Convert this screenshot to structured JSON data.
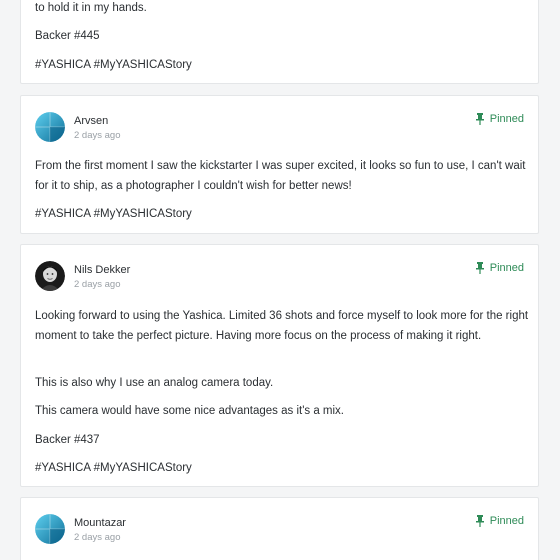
{
  "posts": [
    {
      "paragraphs": [
        "to hold it in my hands.",
        "Backer #445",
        "#YASHICA #MyYASHICAStory"
      ]
    },
    {
      "author": "Arvsen",
      "date": "2 days ago",
      "pinned_label": "Pinned",
      "avatar_icon": "teal-sphere-avatar-icon",
      "paragraphs": [
        "From the first moment I saw the kickstarter I was super excited, it looks so fun to use, I can't wait for it to ship, as a photographer I couldn't wish for better news!",
        "#YASHICA #MyYASHICAStory"
      ]
    },
    {
      "author": "Nils Dekker",
      "date": "2 days ago",
      "pinned_label": "Pinned",
      "avatar_icon": "user-photo-avatar",
      "paragraphs": [
        "Looking forward to using the Yashica. Limited 36 shots and force myself to look more for the right moment to take the perfect picture. Having more focus on the process of making it right.",
        "This is also why I use an analog camera today.",
        "This camera would have some nice advantages as it's a mix.",
        "Backer #437",
        "#YASHICA #MyYASHICAStory"
      ]
    },
    {
      "author": "Mountazar",
      "date": "2 days ago",
      "pinned_label": "Pinned",
      "avatar_icon": "teal-sphere-avatar-icon"
    }
  ],
  "colors": {
    "accent": "#2e8b57",
    "muted": "#9aa0a6",
    "avatar_teal": "#1e9fd0"
  }
}
